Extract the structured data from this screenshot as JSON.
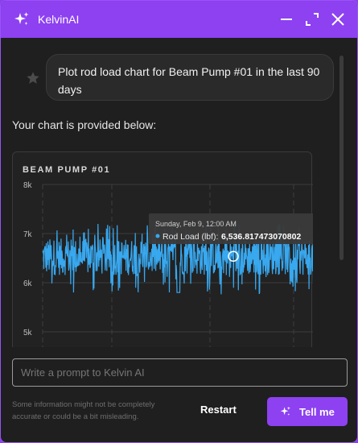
{
  "window": {
    "title": "KelvinAI",
    "accent": "#8d41f1"
  },
  "messages": {
    "user_prompt": "Plot rod load chart for Beam Pump #01 in the last 90 days",
    "answer_text": "Your chart is provided below:"
  },
  "chart_data": {
    "type": "line",
    "title": "BEAM PUMP #01",
    "series": [
      {
        "name": "Rod Load (lbf)",
        "color": "#38a8ef",
        "y_mean": 6500,
        "y_band_min": 6150,
        "y_band_max": 6900,
        "y_peak_max": 7200,
        "y_dip_min": 5750
      }
    ],
    "ylim": [
      5000,
      8000
    ],
    "y_ticks": [
      "8k",
      "7k",
      "6k",
      "5k"
    ],
    "y_tick_values": [
      8000,
      7000,
      6000,
      5000
    ],
    "grid": true,
    "tooltip": {
      "date": "Sunday, Feb 9, 12:00 AM",
      "series_label": "Rod Load (lbf):",
      "value": "6,536.817473070802",
      "y": 6536.817473070802
    }
  },
  "input": {
    "placeholder": "Write a prompt to Kelvin AI"
  },
  "footer": {
    "disclaimer": "Some information might not be completely accurate or could be a bit misleading.",
    "restart_label": "Restart",
    "tell_me_label": "Tell me"
  }
}
